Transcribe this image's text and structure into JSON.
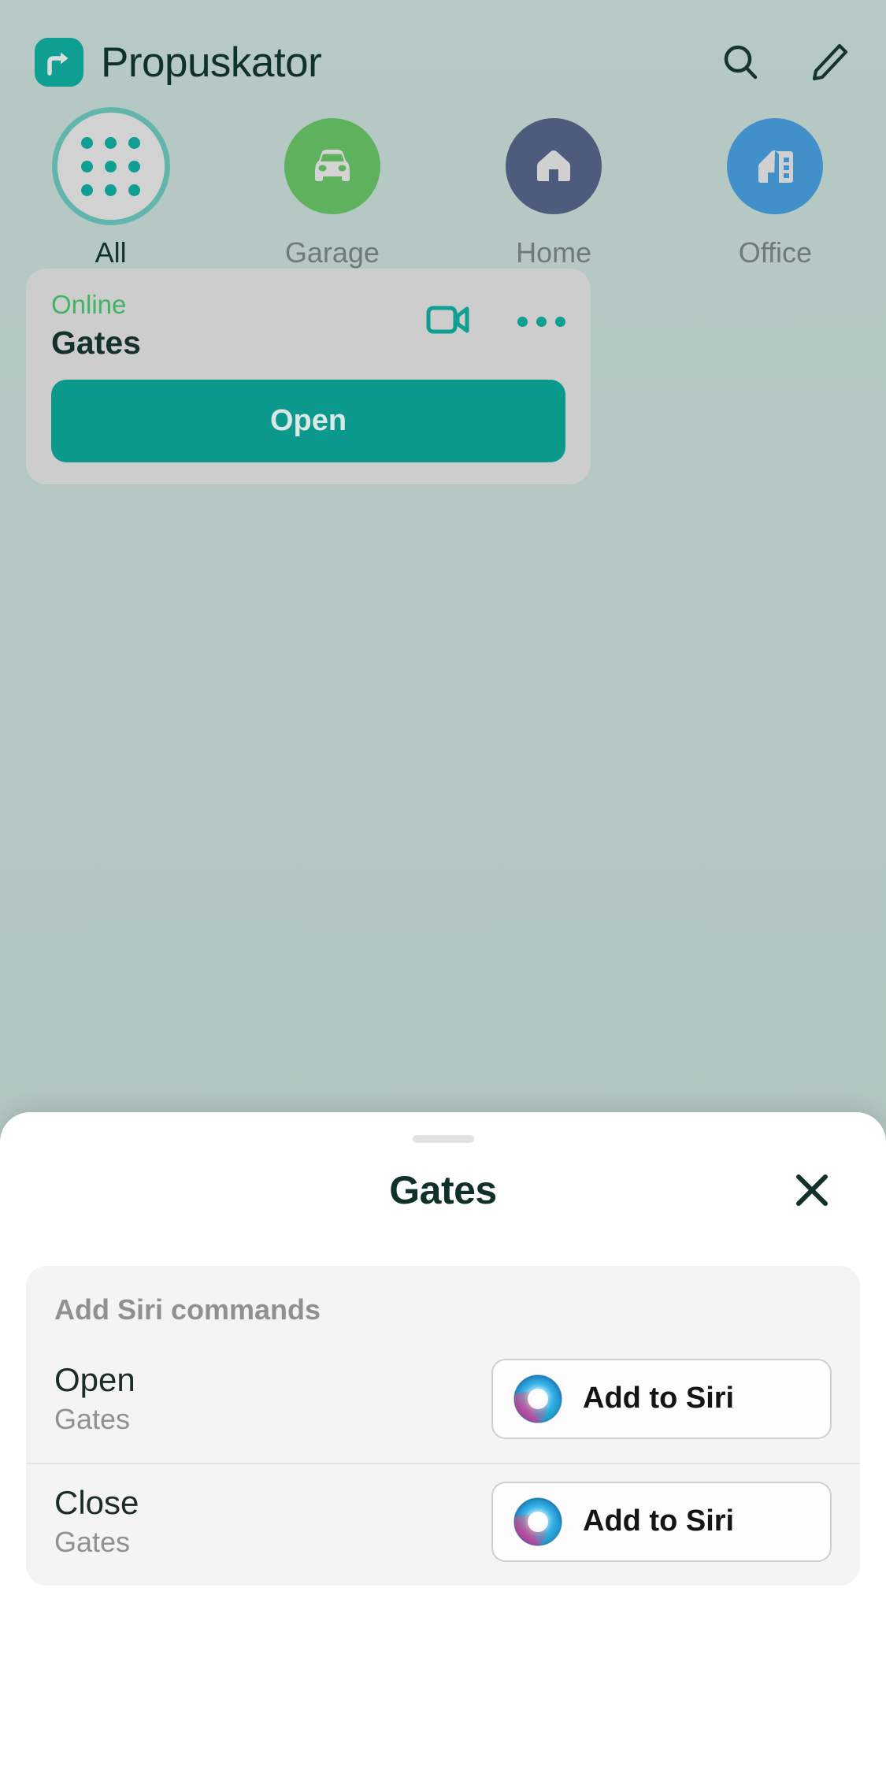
{
  "app": {
    "title": "Propuskator",
    "logo_icon": "share-arrow-logo-icon",
    "brand_color": "#0f9e92",
    "background_color": "#b3c7c2"
  },
  "header": {
    "search_icon": "search-icon",
    "edit_icon": "pencil-edit-icon"
  },
  "categories": [
    {
      "label": "All",
      "icon": "grid-dots-icon",
      "color": "#d2d2d2",
      "selected": true
    },
    {
      "label": "Garage",
      "icon": "car-icon",
      "color": "#5eb25e",
      "selected": false
    },
    {
      "label": "Home",
      "icon": "house-icon",
      "color": "#4d5c7d",
      "selected": false
    },
    {
      "label": "Office",
      "icon": "office-building-icon",
      "color": "#4190ca",
      "selected": false
    }
  ],
  "device_card": {
    "status": "Online",
    "status_color": "#3fb563",
    "name": "Gates",
    "video_icon": "video-camera-icon",
    "more_icon": "more-horizontal-icon",
    "open_label": "Open",
    "open_color": "#0c998d"
  },
  "sheet": {
    "title": "Gates",
    "close_icon": "close-x-icon",
    "grabber": "drag-handle",
    "group_title": "Add Siri commands",
    "rows": [
      {
        "command": "Open",
        "subtitle": "Gates",
        "button_label": "Add to Siri",
        "button_icon": "siri-orb-icon"
      },
      {
        "command": "Close",
        "subtitle": "Gates",
        "button_label": "Add to Siri",
        "button_icon": "siri-orb-icon"
      }
    ]
  }
}
